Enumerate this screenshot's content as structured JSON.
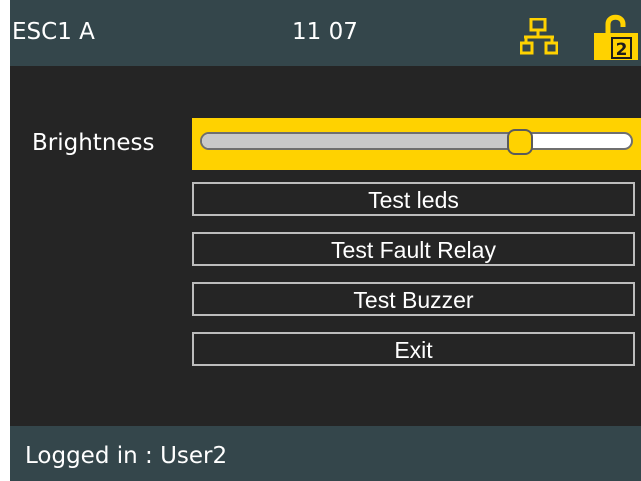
{
  "header": {
    "title": "ESC1 A",
    "time": "11 07",
    "network_icon": "network-icon",
    "lock_icon": "unlock-icon",
    "lock_level": "2",
    "accent_color": "#ffd200"
  },
  "settings": {
    "brightness_label": "Brightness",
    "brightness_level": 0.74,
    "buttons": [
      {
        "label": "Test leds"
      },
      {
        "label": "Test Fault Relay"
      },
      {
        "label": "Test Buzzer"
      },
      {
        "label": "Exit"
      }
    ]
  },
  "status": {
    "text": "Logged in : User2"
  },
  "colors": {
    "header_bg": "#34464b",
    "main_bg": "#252525",
    "text": "#ffffff",
    "focus": "#ffd200"
  }
}
